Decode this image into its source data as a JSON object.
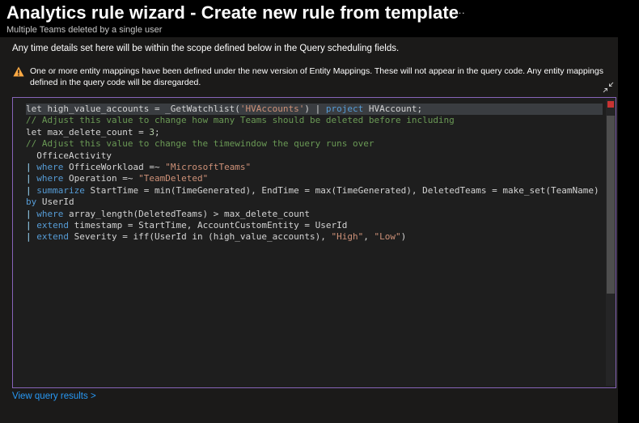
{
  "header": {
    "title": "Analytics rule wizard - Create new rule from template",
    "more_label": "···",
    "subtitle": "Multiple Teams deleted by a single user"
  },
  "info_text": "Any time details set here will be within the scope defined below in the Query scheduling fields.",
  "warning": {
    "icon": "warning-icon",
    "text": "One or more entity mappings have been defined under the new version of Entity Mappings. These will not appear in the query code. Any entity mappings defined in the query code will be disregarded."
  },
  "collapse_icon": "collapse-icon",
  "query_lines": [
    [
      {
        "t": "let high_value_accounts = _GetWatchlist(",
        "c": ""
      },
      {
        "t": "'HVAccounts'",
        "c": "st"
      },
      {
        "t": ") | ",
        "c": ""
      },
      {
        "t": "project",
        "c": "kw"
      },
      {
        "t": " HVAccount;",
        "c": ""
      }
    ],
    [
      {
        "t": "// Adjust this value to change how many Teams should be deleted before including",
        "c": "cm"
      }
    ],
    [
      {
        "t": "let max_delete_count = ",
        "c": ""
      },
      {
        "t": "3",
        "c": "nm"
      },
      {
        "t": ";",
        "c": ""
      }
    ],
    [
      {
        "t": "// Adjust this value to change the timewindow the query runs over",
        "c": "cm"
      }
    ],
    [
      {
        "t": "  OfficeActivity",
        "c": ""
      }
    ],
    [
      {
        "t": "| ",
        "c": "bar"
      },
      {
        "t": "where",
        "c": "kw"
      },
      {
        "t": " OfficeWorkload =~ ",
        "c": ""
      },
      {
        "t": "\"MicrosoftTeams\"",
        "c": "st"
      }
    ],
    [
      {
        "t": "| ",
        "c": "bar"
      },
      {
        "t": "where",
        "c": "kw"
      },
      {
        "t": " Operation =~ ",
        "c": ""
      },
      {
        "t": "\"TeamDeleted\"",
        "c": "st"
      }
    ],
    [
      {
        "t": "| ",
        "c": "bar"
      },
      {
        "t": "summarize",
        "c": "kw"
      },
      {
        "t": " StartTime = min(TimeGenerated), EndTime = max(TimeGenerated), DeletedTeams = make_set(TeamName)",
        "c": ""
      }
    ],
    [
      {
        "t": "by",
        "c": "kw"
      },
      {
        "t": " UserId",
        "c": ""
      }
    ],
    [
      {
        "t": "| ",
        "c": "bar"
      },
      {
        "t": "where",
        "c": "kw"
      },
      {
        "t": " array_length(DeletedTeams) > max_delete_count",
        "c": ""
      }
    ],
    [
      {
        "t": "| ",
        "c": "bar"
      },
      {
        "t": "extend",
        "c": "kw"
      },
      {
        "t": " timestamp = StartTime, AccountCustomEntity = UserId",
        "c": ""
      }
    ],
    [
      {
        "t": "| ",
        "c": "bar"
      },
      {
        "t": "extend",
        "c": "kw"
      },
      {
        "t": " Severity = iff(UserId in (high_value_accounts), ",
        "c": ""
      },
      {
        "t": "\"High\"",
        "c": "st"
      },
      {
        "t": ", ",
        "c": ""
      },
      {
        "t": "\"Low\"",
        "c": "st"
      },
      {
        "t": ")",
        "c": ""
      }
    ]
  ],
  "view_results_link": "View query results >",
  "colors": {
    "accent_border": "#8764b8",
    "link": "#2899f5",
    "warning": "#ffaa44"
  }
}
